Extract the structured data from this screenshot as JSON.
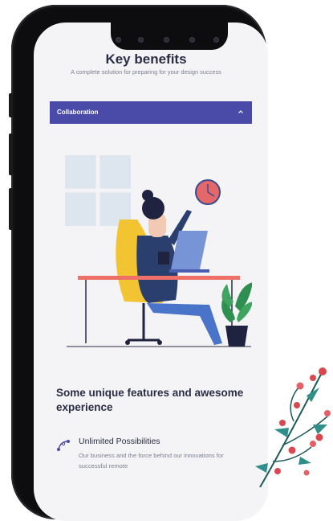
{
  "header": {
    "title": "Key benefits",
    "subtitle": "A complete solution for preparing for your design success"
  },
  "accordion": {
    "label": "Collaboration",
    "expanded": true,
    "color": "#4a4aa8"
  },
  "section": {
    "heading": "Some unique features and awesome experience"
  },
  "feature": {
    "icon": "bezier-curve-icon",
    "title": "Unlimited Possibilities",
    "description": "Our business and the force behind our innovations for successful remote"
  }
}
